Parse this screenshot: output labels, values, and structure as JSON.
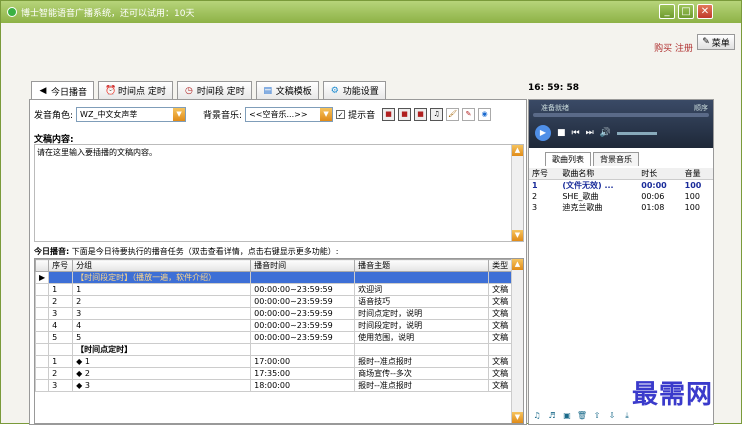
{
  "window": {
    "title": "博士智能语音广播系统，还可以试用：10天",
    "buy_register": "购买 注册",
    "menu_label": "菜单"
  },
  "tabs": [
    {
      "label": "今日播音",
      "icon": "speaker-icon"
    },
    {
      "label": "时间点 定时",
      "icon": "alarm-clock-icon"
    },
    {
      "label": "时间段 定时",
      "icon": "clock-icon"
    },
    {
      "label": "文稿模板",
      "icon": "document-icon"
    },
    {
      "label": "功能设置",
      "icon": "settings-icon"
    }
  ],
  "clock": "16: 59: 58",
  "controls": {
    "voice_label": "发音角色:",
    "voice_value": "WZ_中文女声莘",
    "bgm_label": "背景音乐:",
    "bgm_value": "<<空音乐...>>",
    "prompt_label": "提示音"
  },
  "content": {
    "label": "文稿内容:",
    "placeholder": "请在这里输入要插播的文稿内容。"
  },
  "today": {
    "title": "今日播音:",
    "hint": "下面是今日待要执行的播音任务（双击查看详情，点击右键显示更多功能）:"
  },
  "table": {
    "headers": [
      "序号",
      "分组",
      "播音时间",
      "播音主题",
      "类型"
    ],
    "rows": [
      {
        "no": "",
        "group": "【时间段定时】（播放一遍，软件介绍）",
        "time": "",
        "topic": "",
        "type": "",
        "style": "sel"
      },
      {
        "no": "1",
        "group": "1",
        "time": "00:00:00~23:59:59",
        "topic": "欢迎词",
        "type": "文稿"
      },
      {
        "no": "2",
        "group": "2",
        "time": "00:00:00~23:59:59",
        "topic": "语音技巧",
        "type": "文稿"
      },
      {
        "no": "3",
        "group": "3",
        "time": "00:00:00~23:59:59",
        "topic": "时间点定时，说明",
        "type": "文稿"
      },
      {
        "no": "4",
        "group": "4",
        "time": "00:00:00~23:59:59",
        "topic": "时间段定时，说明",
        "type": "文稿"
      },
      {
        "no": "5",
        "group": "5",
        "time": "00:00:00~23:59:59",
        "topic": "使用范围，说明",
        "type": "文稿"
      },
      {
        "no": "",
        "group": "【时间点定时】",
        "time": "",
        "topic": "",
        "type": "",
        "style": "group"
      },
      {
        "no": "1",
        "group": "◆ 1",
        "time": "17:00:00",
        "topic": "报时--准点报时",
        "type": "文稿"
      },
      {
        "no": "2",
        "group": "◆ 2",
        "time": "17:35:00",
        "topic": "商场宣传--多次",
        "type": "文稿"
      },
      {
        "no": "3",
        "group": "◆ 3",
        "time": "18:00:00",
        "topic": "报时--准点报时",
        "type": "文稿"
      }
    ]
  },
  "player": {
    "status": "准备就绪",
    "mode": "顺序"
  },
  "song_tabs": [
    "歌曲列表",
    "背景音乐"
  ],
  "songs": {
    "headers": [
      "序号",
      "歌曲名称",
      "时长",
      "音量"
    ],
    "rows": [
      {
        "no": "1",
        "name": "(文件无效) ...",
        "duration": "00:00",
        "volume": "100"
      },
      {
        "no": "2",
        "name": "SHE_歌曲",
        "duration": "00:06",
        "volume": "100"
      },
      {
        "no": "3",
        "name": "迪克兰歌曲",
        "duration": "01:08",
        "volume": "100"
      }
    ]
  },
  "watermark": "最需网"
}
